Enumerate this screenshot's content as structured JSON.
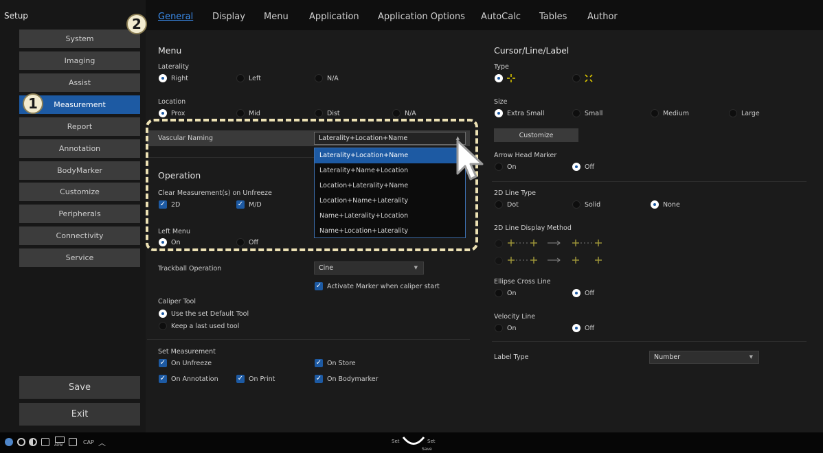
{
  "setup_title": "Setup",
  "sidebar": {
    "items": [
      "System",
      "Imaging",
      "Assist",
      "Measurement",
      "Report",
      "Annotation",
      "BodyMarker",
      "Customize",
      "Peripherals",
      "Connectivity",
      "Service"
    ],
    "active": "Measurement",
    "save_label": "Save",
    "exit_label": "Exit"
  },
  "callouts": {
    "one": "1",
    "two": "2"
  },
  "tabs": [
    "General",
    "Display",
    "Menu",
    "Application",
    "Application Options",
    "AutoCalc",
    "Tables",
    "Author"
  ],
  "active_tab": "General",
  "menu": {
    "title": "Menu",
    "laterality": {
      "label": "Laterality",
      "options": [
        "Right",
        "Left",
        "N/A"
      ],
      "selected": "Right"
    },
    "location": {
      "label": "Location",
      "options": [
        "Prox",
        "Mid",
        "Dist",
        "N/A"
      ],
      "selected": "Prox"
    },
    "vascular_naming": {
      "label": "Vascular Naming",
      "value": "Laterality+Location+Name",
      "options": [
        "Laterality+Location+Name",
        "Laterality+Name+Location",
        "Location+Laterality+Name",
        "Location+Name+Laterality",
        "Name+Laterality+Location",
        "Name+Location+Laterality"
      ]
    }
  },
  "operation": {
    "title": "Operation",
    "clear_label": "Clear Measurement(s) on Unfreeze",
    "clear_2d": "2D",
    "clear_md": "M/D",
    "left_menu": {
      "label": "Left Menu",
      "options": [
        "On",
        "Off"
      ],
      "selected": "On"
    },
    "trackball": {
      "label": "Trackball Operation",
      "value": "Cine",
      "activate_marker": "Activate Marker when caliper start"
    },
    "caliper": {
      "label": "Caliper Tool",
      "options": [
        "Use the set Default Tool",
        "Keep a last used tool"
      ],
      "selected": "Use the set Default Tool"
    },
    "set_measurement": {
      "label": "Set Measurement",
      "options": [
        "On Unfreeze",
        "On Store",
        "On Annotation",
        "On Print",
        "On Bodymarker"
      ]
    }
  },
  "cursor": {
    "title": "Cursor/Line/Label",
    "type_label": "Type",
    "size": {
      "label": "Size",
      "options": [
        "Extra Small",
        "Small",
        "Medium",
        "Large"
      ],
      "selected": "Extra Small"
    },
    "customize_label": "Customize",
    "arrow_head": {
      "label": "Arrow Head Marker",
      "options": [
        "On",
        "Off"
      ],
      "selected": "Off"
    },
    "line_type": {
      "label": "2D Line Type",
      "options": [
        "Dot",
        "Solid",
        "None"
      ],
      "selected": "None"
    },
    "line_display_label": "2D Line Display Method",
    "ellipse": {
      "label": "Ellipse Cross Line",
      "options": [
        "On",
        "Off"
      ],
      "selected": "Off"
    },
    "velocity": {
      "label": "Velocity Line",
      "options": [
        "On",
        "Off"
      ],
      "selected": "Off"
    },
    "label_type": {
      "label": "Label Type",
      "value": "Number"
    }
  },
  "statusbar": {
    "cap_label": "CAP",
    "set_left": "Set",
    "set_right": "Set",
    "save_small": "Save",
    "adw_label": "ADW"
  },
  "colors": {
    "accent": "#1d5aa3",
    "active_tab": "#3b8ef0",
    "highlight_dash": "#ece1b4",
    "cursor_yellow": "#d9c400"
  }
}
